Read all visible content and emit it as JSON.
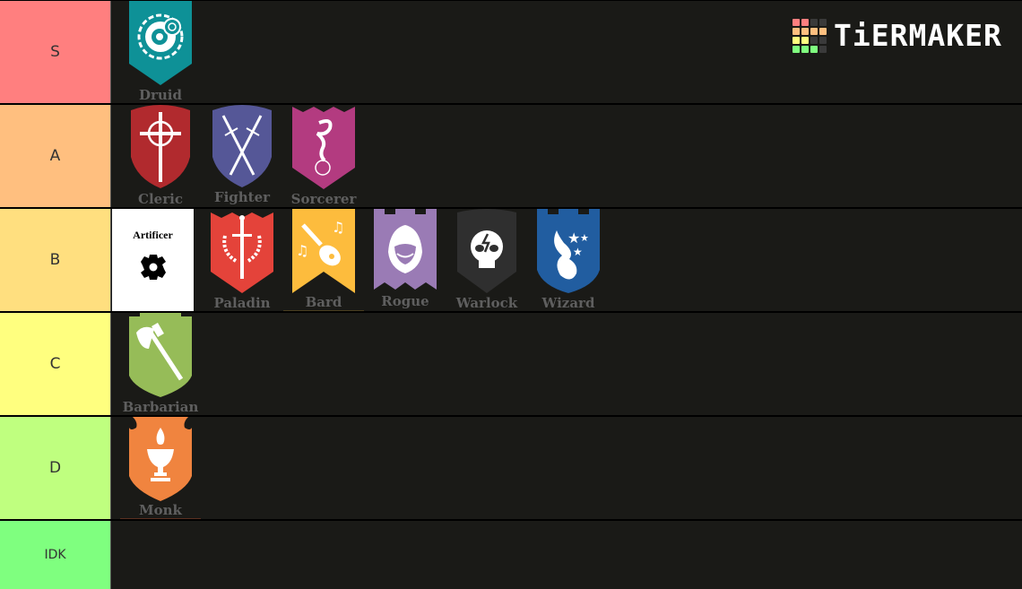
{
  "logo": {
    "text": "TiERMAKER",
    "grid_colors": [
      "#ff7f7f",
      "#ff7f7f",
      "#3a3a3a",
      "#3a3a3a",
      "#ffbf7f",
      "#ffbf7f",
      "#ffbf7f",
      "#ffbf7f",
      "#ffff7f",
      "#ffff7f",
      "#3a3a3a",
      "#3a3a3a",
      "#7fff7f",
      "#7fff7f",
      "#7fff7f",
      "#3a3a3a"
    ]
  },
  "tiers": [
    {
      "label": "S",
      "color": "#ff7f7f",
      "items": [
        {
          "name": "Druid",
          "color": "#0e9197",
          "icon": "celtic-sun-icon"
        }
      ]
    },
    {
      "label": "A",
      "color": "#ffbf7f",
      "items": [
        {
          "name": "Cleric",
          "color": "#b12a2e",
          "icon": "celtic-cross-icon"
        },
        {
          "name": "Fighter",
          "color": "#555797",
          "icon": "crossed-swords-icon"
        },
        {
          "name": "Sorcerer",
          "color": "#b33b80",
          "icon": "magic-smoke-orb-icon"
        }
      ]
    },
    {
      "label": "B",
      "color": "#ffdf7f",
      "items": [
        {
          "name": "Artificer",
          "color": "#ffffff",
          "icon": "gear-icon"
        },
        {
          "name": "Paladin",
          "color": "#e4433a",
          "icon": "sword-laurel-icon"
        },
        {
          "name": "Bard",
          "color": "#fdbc3d",
          "icon": "lute-notes-icon"
        },
        {
          "name": "Rogue",
          "color": "#9a7bb5",
          "icon": "hooded-figure-icon"
        },
        {
          "name": "Warlock",
          "color": "#2f2f2f",
          "icon": "lightning-skull-icon"
        },
        {
          "name": "Wizard",
          "color": "#215da0",
          "icon": "stars-flame-icon"
        }
      ]
    },
    {
      "label": "C",
      "color": "#ffff7f",
      "items": [
        {
          "name": "Barbarian",
          "color": "#96bc58",
          "icon": "battle-axe-icon"
        }
      ]
    },
    {
      "label": "D",
      "color": "#bfff7f",
      "items": [
        {
          "name": "Monk",
          "color": "#f0843f",
          "icon": "chalice-flame-icon"
        }
      ]
    },
    {
      "label": "IDK",
      "color": "#7fff7f",
      "items": []
    }
  ]
}
